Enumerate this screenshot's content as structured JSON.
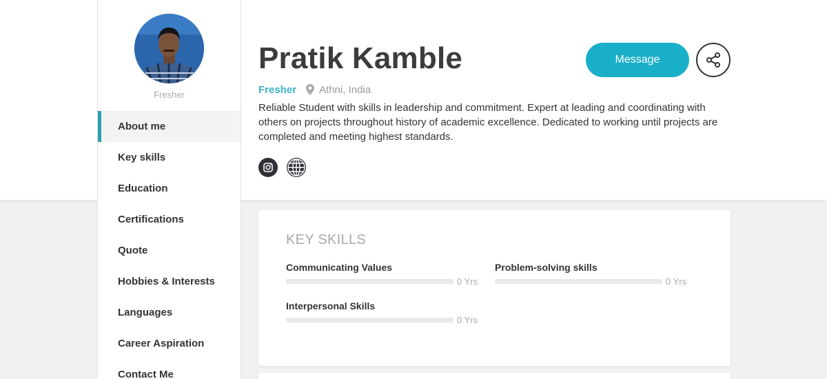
{
  "profile": {
    "name": "Pratik Kamble",
    "role": "Fresher",
    "status": "Fresher",
    "location": "Athni, India",
    "bio": "Reliable Student with skills in leadership and commitment. Expert at leading and coordinating with others on projects throughout history of academic excellence. Dedicated to working until projects are completed and meeting highest standards."
  },
  "actions": {
    "message_label": "Message",
    "share_icon": "share-icon"
  },
  "social": [
    {
      "icon": "instagram-icon"
    },
    {
      "icon": "globe-icon"
    }
  ],
  "sidebar": {
    "items": [
      {
        "label": "About me",
        "active": true
      },
      {
        "label": "Key skills"
      },
      {
        "label": "Education"
      },
      {
        "label": "Certifications"
      },
      {
        "label": "Quote"
      },
      {
        "label": "Hobbies & Interests"
      },
      {
        "label": "Languages"
      },
      {
        "label": "Career Aspiration"
      },
      {
        "label": "Contact Me"
      }
    ]
  },
  "key_skills": {
    "title": "KEY SKILLS",
    "skills": [
      {
        "name": "Communicating Values",
        "years": "0 Yrs",
        "level": 0
      },
      {
        "name": "Problem-solving skills",
        "years": "0 Yrs",
        "level": 0
      },
      {
        "name": "Interpersonal Skills",
        "years": "0 Yrs",
        "level": 0
      }
    ]
  },
  "colors": {
    "accent": "#1aafc8",
    "status": "#3bb4c7",
    "active_border": "#2b9fb1"
  }
}
